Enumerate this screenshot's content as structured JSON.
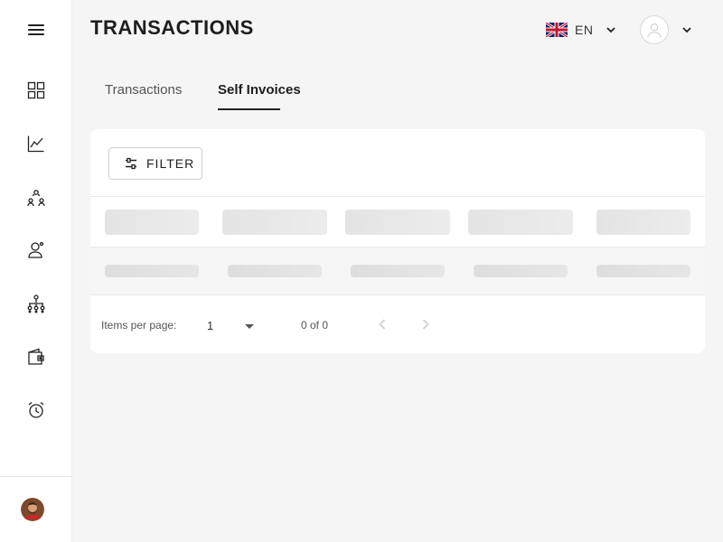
{
  "header": {
    "title": "TRANSACTIONS",
    "language": {
      "code": "EN",
      "flag": "uk-flag-icon"
    },
    "profile": {
      "icon": "user-icon"
    }
  },
  "sidebar": {
    "menu_icon": "hamburger-menu-icon",
    "items": [
      {
        "icon": "dashboard-grid-icon"
      },
      {
        "icon": "chart-line-icon"
      },
      {
        "icon": "users-network-icon"
      },
      {
        "icon": "user-settings-icon"
      },
      {
        "icon": "hierarchy-icon"
      },
      {
        "icon": "wallet-icon"
      },
      {
        "icon": "timer-icon"
      }
    ],
    "user_avatar": "user-avatar"
  },
  "tabs": [
    {
      "label": "Transactions",
      "active": false
    },
    {
      "label": "Self Invoices",
      "active": true
    }
  ],
  "toolbar": {
    "filter_label": "FILTER",
    "filter_icon": "sliders-icon"
  },
  "table": {
    "loading": true,
    "header_placeholders": 5,
    "row_placeholders": 5
  },
  "paginator": {
    "items_per_page_label": "Items per page:",
    "items_per_page_value": "1",
    "range_label": "0 of 0",
    "prev_icon": "chevron-left-icon",
    "next_icon": "chevron-right-icon"
  },
  "colors": {
    "background": "#f5f5f5",
    "card": "#ffffff",
    "text_primary": "#1e1e1e",
    "skeleton": "#e4e4e4"
  }
}
